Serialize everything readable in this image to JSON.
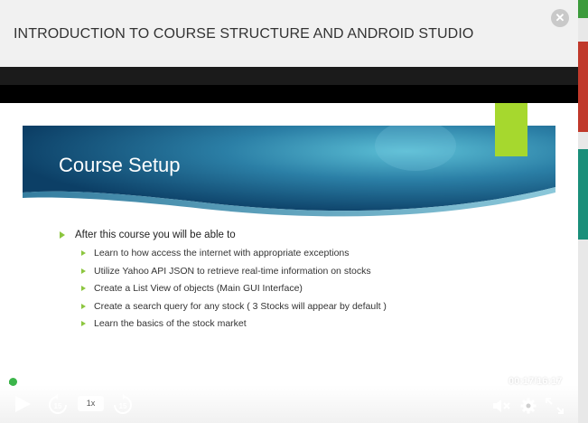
{
  "modal": {
    "title": "INTRODUCTION TO COURSE STRUCTURE AND ANDROID STUDIO",
    "close_icon": "close-circle-icon"
  },
  "slide": {
    "title": "Course Setup",
    "intro": "After this course you will be able to",
    "items": [
      "Learn to how access the internet with appropriate exceptions",
      "Utilize Yahoo API JSON to retrieve real-time information on stocks",
      "Create a List View of objects (Main GUI Interface)",
      "Create a search query for any stock ( 3 Stocks will appear by default )",
      "Learn the basics of the stock market"
    ],
    "colors": {
      "banner_dark": "#0e4a6e",
      "banner_light": "#3fa0bb",
      "accent_green": "#a6d82e",
      "bullet": "#8cc63f"
    }
  },
  "player": {
    "time": "00:17/16:17",
    "speed": "1x",
    "progress_fraction": 0.017,
    "icons": [
      "play-icon",
      "rewind-15-icon",
      "forward-15-icon",
      "mute-icon",
      "settings-gear-icon",
      "fullscreen-icon"
    ]
  }
}
